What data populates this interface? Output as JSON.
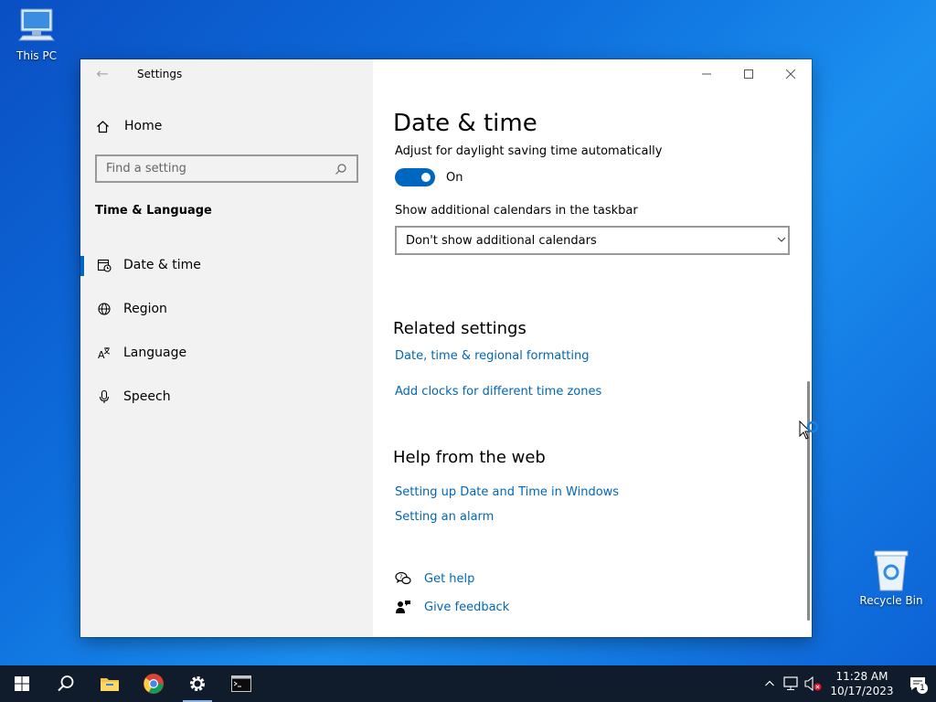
{
  "desktop": {
    "this_pc_label": "This PC",
    "recycle_bin_label": "Recycle Bin"
  },
  "window": {
    "title": "Settings",
    "controls": {
      "minimize_icon": "minimize-icon",
      "maximize_icon": "maximize-icon",
      "close_icon": "close-icon"
    }
  },
  "sidebar": {
    "home_label": "Home",
    "search_placeholder": "Find a setting",
    "section_title": "Time & Language",
    "items": [
      {
        "label": "Date & time",
        "icon": "calendar-clock-icon",
        "active": true
      },
      {
        "label": "Region",
        "icon": "globe-icon",
        "active": false
      },
      {
        "label": "Language",
        "icon": "language-icon",
        "active": false
      },
      {
        "label": "Speech",
        "icon": "microphone-icon",
        "active": false
      }
    ]
  },
  "content": {
    "page_title": "Date & time",
    "dst_label": "Adjust for daylight saving time automatically",
    "dst_toggle_state": "On",
    "calendar_label": "Show additional calendars in the taskbar",
    "calendar_value": "Don't show additional calendars",
    "related_heading": "Related settings",
    "related_links": [
      "Date, time & regional formatting",
      "Add clocks for different time zones"
    ],
    "help_heading": "Help from the web",
    "help_links": [
      "Setting up Date and Time in Windows",
      "Setting an alarm"
    ],
    "get_help_label": "Get help",
    "give_feedback_label": "Give feedback"
  },
  "taskbar": {
    "time": "11:28 AM",
    "date": "10/17/2023",
    "notification_count": "1"
  },
  "colors": {
    "accent": "#0067c0",
    "link": "#0067b8",
    "taskbar": "#101c2b",
    "sidebar": "#f2f2f2"
  }
}
